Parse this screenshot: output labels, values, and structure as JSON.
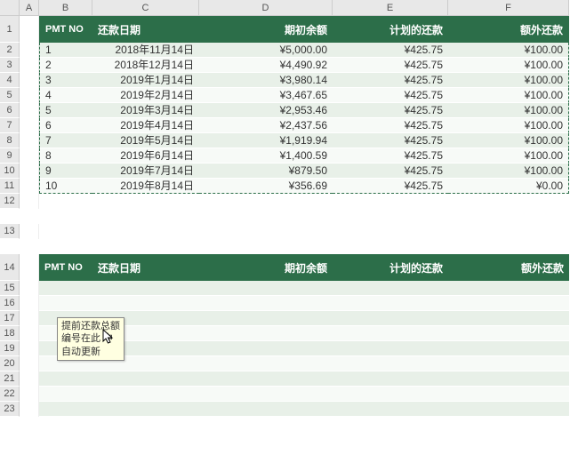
{
  "columns": [
    "",
    "A",
    "B",
    "C",
    "D",
    "E",
    "F"
  ],
  "row_numbers": [
    "1",
    "2",
    "3",
    "4",
    "5",
    "6",
    "7",
    "8",
    "9",
    "10",
    "11",
    "12",
    "13",
    "14",
    "15",
    "16",
    "17",
    "18",
    "19",
    "20",
    "21",
    "22",
    "23"
  ],
  "table1": {
    "headers": {
      "pmtno": "PMT NO",
      "date": "还款日期",
      "begin_bal": "期初余额",
      "scheduled": "计划的还款",
      "extra": "额外还款"
    },
    "rows": [
      {
        "no": "1",
        "date": "2018年11月14日",
        "bal": "¥5,000.00",
        "sch": "¥425.75",
        "ext": "¥100.00"
      },
      {
        "no": "2",
        "date": "2018年12月14日",
        "bal": "¥4,490.92",
        "sch": "¥425.75",
        "ext": "¥100.00"
      },
      {
        "no": "3",
        "date": "2019年1月14日",
        "bal": "¥3,980.14",
        "sch": "¥425.75",
        "ext": "¥100.00"
      },
      {
        "no": "4",
        "date": "2019年2月14日",
        "bal": "¥3,467.65",
        "sch": "¥425.75",
        "ext": "¥100.00"
      },
      {
        "no": "5",
        "date": "2019年3月14日",
        "bal": "¥2,953.46",
        "sch": "¥425.75",
        "ext": "¥100.00"
      },
      {
        "no": "6",
        "date": "2019年4月14日",
        "bal": "¥2,437.56",
        "sch": "¥425.75",
        "ext": "¥100.00"
      },
      {
        "no": "7",
        "date": "2019年5月14日",
        "bal": "¥1,919.94",
        "sch": "¥425.75",
        "ext": "¥100.00"
      },
      {
        "no": "8",
        "date": "2019年6月14日",
        "bal": "¥1,400.59",
        "sch": "¥425.75",
        "ext": "¥100.00"
      },
      {
        "no": "9",
        "date": "2019年7月14日",
        "bal": "¥879.50",
        "sch": "¥425.75",
        "ext": "¥100.00"
      },
      {
        "no": "10",
        "date": "2019年8月14日",
        "bal": "¥356.69",
        "sch": "¥425.75",
        "ext": "¥0.00"
      }
    ]
  },
  "table2": {
    "headers": {
      "pmtno": "PMT NO",
      "date": "还款日期",
      "begin_bal": "期初余额",
      "scheduled": "计划的还款",
      "extra": "额外还款"
    }
  },
  "tooltip": {
    "line1": "提前还款总额",
    "line2": "编号在此  中",
    "line3": "自动更新"
  }
}
